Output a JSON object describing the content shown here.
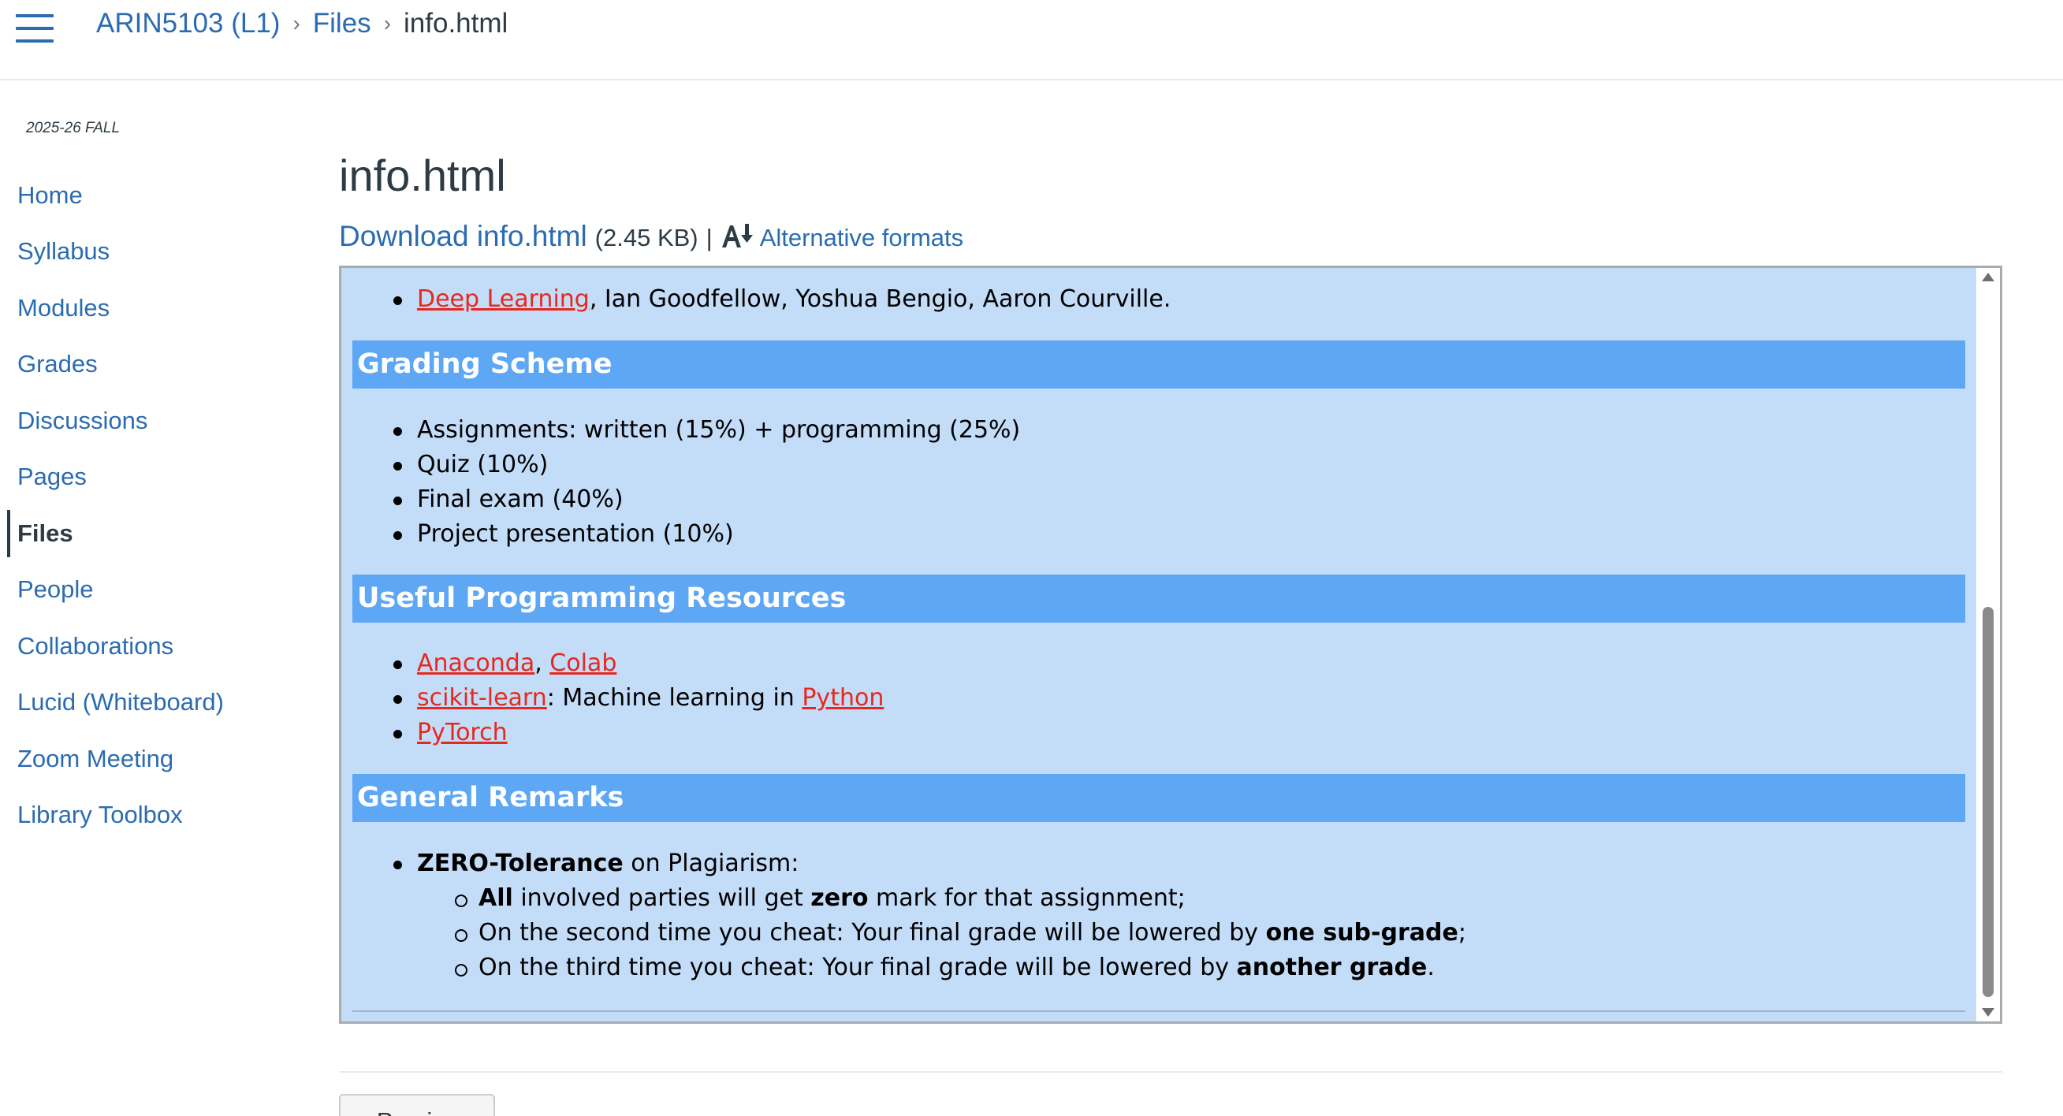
{
  "breadcrumb": {
    "course": "ARIN5103 (L1)",
    "files": "Files",
    "current": "info.html"
  },
  "sidebar": {
    "term": "2025-26 FALL",
    "items": [
      {
        "label": "Home"
      },
      {
        "label": "Syllabus"
      },
      {
        "label": "Modules"
      },
      {
        "label": "Grades"
      },
      {
        "label": "Discussions"
      },
      {
        "label": "Pages"
      },
      {
        "label": "Files",
        "active": true
      },
      {
        "label": "People"
      },
      {
        "label": "Collaborations"
      },
      {
        "label": "Lucid (Whiteboard)"
      },
      {
        "label": "Zoom Meeting"
      },
      {
        "label": "Library Toolbox"
      }
    ]
  },
  "main": {
    "title": "info.html",
    "download_label": "Download info.html",
    "file_size": "(2.45 KB)",
    "separator": "|",
    "alt_formats_label": "Alternative formats",
    "previous_label": "Previous"
  },
  "preview": {
    "top_item": {
      "link": "Deep Learning",
      "text": ", Ian Goodfellow, Yoshua Bengio, Aaron Courville."
    },
    "grading": {
      "heading": "Grading Scheme",
      "items": [
        "Assignments: written (15%) + programming (25%)",
        "Quiz (10%)",
        "Final exam (40%)",
        "Project presentation (10%)"
      ]
    },
    "resources": {
      "heading": "Useful Programming Resources",
      "anaconda": "Anaconda",
      "comma": ", ",
      "colab": "Colab",
      "sklearn": "scikit-learn",
      "ml_text": ": Machine learning in ",
      "python": "Python",
      "pytorch": "PyTorch"
    },
    "remarks": {
      "heading": "General Remarks",
      "zero_bold": "ZERO-Tolerance",
      "zero_rest": " on Plagiarism:",
      "sub1_bold_a": "All",
      "sub1_mid": " involved parties will get ",
      "sub1_bold_b": "zero",
      "sub1_rest": " mark for that assignment;",
      "sub2_text": "On the second time you cheat: Your final grade will be lowered by ",
      "sub2_bold": "one sub-grade",
      "sub2_end": ";",
      "sub3_text": "On the third time you cheat: Your final grade will be lowered by ",
      "sub3_bold": "another grade",
      "sub3_end": "."
    }
  },
  "colors": {
    "link_blue": "#2b6cb0",
    "preview_bg": "#c3dcf8",
    "section_header": "#5ea7f5",
    "red_link": "#e8281e"
  },
  "icons": [
    "hamburger-menu-icon",
    "breadcrumb-chevron-icon",
    "alternative-formats-icon",
    "scroll-up-arrow-icon",
    "scroll-down-arrow-icon",
    "previous-arrow-icon"
  ]
}
